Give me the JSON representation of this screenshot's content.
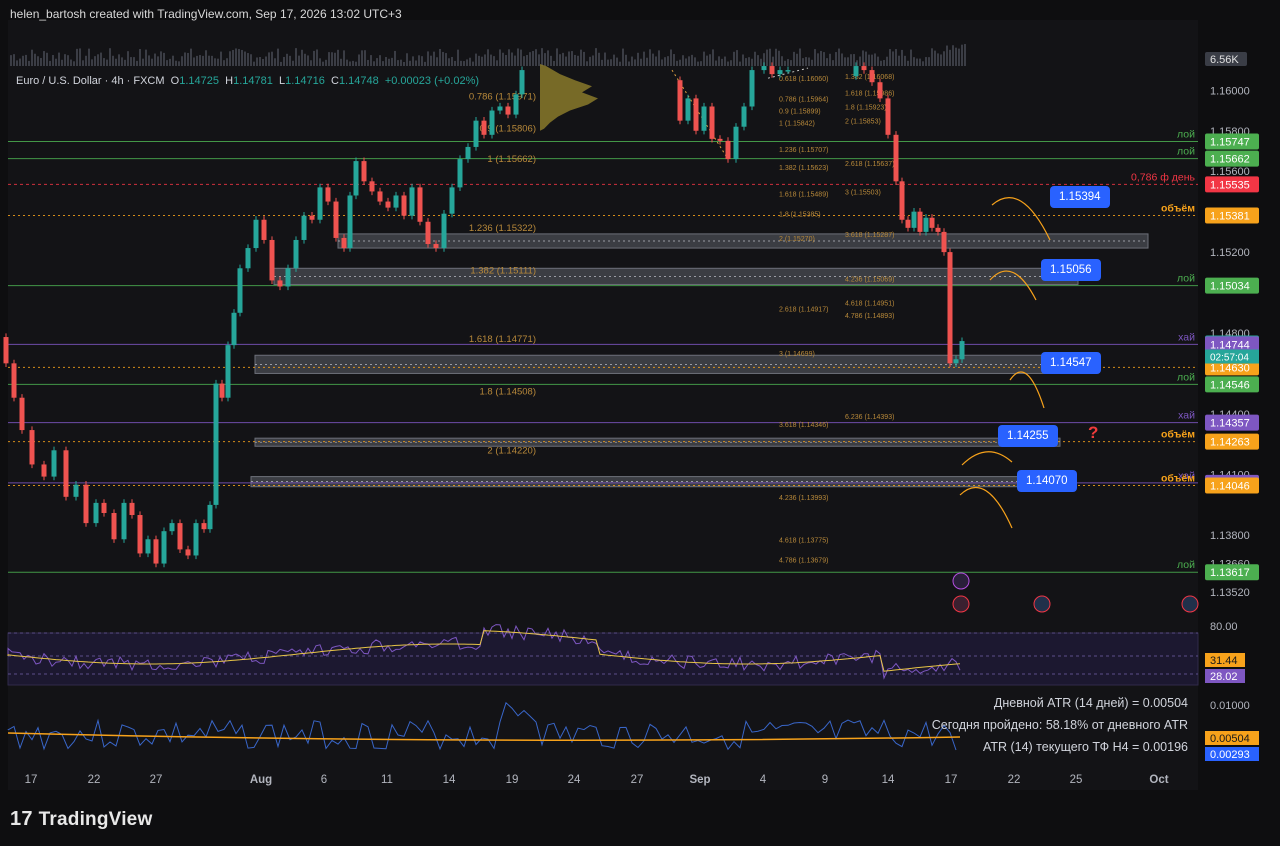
{
  "header": {
    "attribution": "helen_bartosh created with TradingView.com, Sep 17, 2026 13:02 UTC+3"
  },
  "symbol": {
    "name": "Euro / U.S. Dollar · 4h · FXCM",
    "o_label": "O",
    "o": "1.14725",
    "h_label": "H",
    "h": "1.14781",
    "l_label": "L",
    "l": "1.14716",
    "c_label": "C",
    "c": "1.14748",
    "change": "+0.00023 (+0.02%)"
  },
  "volume_badge": "6.56K",
  "colors": {
    "up": "#26a69a",
    "down": "#ef5350",
    "green_level": "#4caf50",
    "red_level": "#f23645",
    "orange": "#f7a21b",
    "purple": "#7e57c2",
    "blue": "#2962ff",
    "fib": "#b8893a",
    "zone": "#5d606b"
  },
  "chart_data": {
    "type": "candlestick",
    "instrument": "Euro / U.S. Dollar",
    "timeframe": "4h",
    "x_ticks": [
      "17",
      "22",
      "27",
      "Aug",
      "6",
      "11",
      "14",
      "19",
      "24",
      "27",
      "Sep",
      "4",
      "9",
      "14",
      "17",
      "22",
      "25",
      "Oct"
    ],
    "ylim": [
      1.1346,
      1.1614
    ],
    "y_ticks": [
      "1.16000",
      "1.15800",
      "1.15600",
      "1.15200",
      "1.14800",
      "1.14400",
      "1.14100",
      "1.13800",
      "1.13660",
      "1.13520"
    ],
    "close_path": [
      [
        0,
        1.1478
      ],
      [
        6,
        1.1465
      ],
      [
        14,
        1.1448
      ],
      [
        22,
        1.1432
      ],
      [
        32,
        1.1415
      ],
      [
        44,
        1.1409
      ],
      [
        54,
        1.1422
      ],
      [
        66,
        1.1399
      ],
      [
        76,
        1.1405
      ],
      [
        86,
        1.1386
      ],
      [
        96,
        1.1396
      ],
      [
        104,
        1.1391
      ],
      [
        114,
        1.1378
      ],
      [
        124,
        1.1396
      ],
      [
        132,
        1.139
      ],
      [
        140,
        1.1371
      ],
      [
        148,
        1.1378
      ],
      [
        156,
        1.1366
      ],
      [
        164,
        1.1382
      ],
      [
        172,
        1.1386
      ],
      [
        180,
        1.1373
      ],
      [
        188,
        1.137
      ],
      [
        196,
        1.1386
      ],
      [
        204,
        1.1383
      ],
      [
        210,
        1.1395
      ],
      [
        216,
        1.1455
      ],
      [
        222,
        1.1448
      ],
      [
        228,
        1.1474
      ],
      [
        234,
        1.149
      ],
      [
        240,
        1.1512
      ],
      [
        248,
        1.1522
      ],
      [
        256,
        1.1536
      ],
      [
        264,
        1.1526
      ],
      [
        272,
        1.1506
      ],
      [
        280,
        1.1503
      ],
      [
        288,
        1.1512
      ],
      [
        296,
        1.1526
      ],
      [
        304,
        1.1538
      ],
      [
        312,
        1.1536
      ],
      [
        320,
        1.1552
      ],
      [
        328,
        1.1545
      ],
      [
        336,
        1.1527
      ],
      [
        344,
        1.1522
      ],
      [
        350,
        1.1548
      ],
      [
        356,
        1.1565
      ],
      [
        364,
        1.1555
      ],
      [
        372,
        1.155
      ],
      [
        380,
        1.1545
      ],
      [
        388,
        1.1542
      ],
      [
        396,
        1.1548
      ],
      [
        404,
        1.1538
      ],
      [
        412,
        1.1552
      ],
      [
        420,
        1.1535
      ],
      [
        428,
        1.1524
      ],
      [
        436,
        1.1522
      ],
      [
        444,
        1.1539
      ],
      [
        452,
        1.1552
      ],
      [
        460,
        1.1566
      ],
      [
        468,
        1.1572
      ],
      [
        476,
        1.1585
      ],
      [
        484,
        1.1578
      ],
      [
        492,
        1.159
      ],
      [
        500,
        1.1592
      ],
      [
        508,
        1.1588
      ],
      [
        516,
        1.1598
      ],
      [
        522,
        1.161
      ],
      [
        672,
        1.1605
      ],
      [
        680,
        1.1585
      ],
      [
        688,
        1.1596
      ],
      [
        696,
        1.158
      ],
      [
        704,
        1.1592
      ],
      [
        712,
        1.1576
      ],
      [
        720,
        1.1575
      ],
      [
        728,
        1.1566
      ],
      [
        736,
        1.1582
      ],
      [
        744,
        1.1592
      ],
      [
        752,
        1.161
      ],
      [
        764,
        1.1612
      ],
      [
        772,
        1.1608
      ],
      [
        780,
        1.161
      ],
      [
        788,
        1.161
      ],
      [
        848,
        1.1607
      ],
      [
        856,
        1.1612
      ],
      [
        864,
        1.161
      ],
      [
        872,
        1.1604
      ],
      [
        880,
        1.1596
      ],
      [
        888,
        1.1578
      ],
      [
        896,
        1.1555
      ],
      [
        902,
        1.1536
      ],
      [
        908,
        1.1532
      ],
      [
        914,
        1.154
      ],
      [
        920,
        1.153
      ],
      [
        926,
        1.1537
      ],
      [
        932,
        1.1532
      ],
      [
        938,
        1.153
      ],
      [
        944,
        1.152
      ],
      [
        950,
        1.1465
      ],
      [
        956,
        1.1467
      ],
      [
        962,
        1.1476
      ]
    ],
    "levels": [
      {
        "price": "1.15747",
        "label": "лой",
        "color": "#4caf50"
      },
      {
        "price": "1.15662",
        "label": "лой",
        "color": "#4caf50"
      },
      {
        "price": "1.15535",
        "label": "0,786 ф день",
        "color": "#f23645"
      },
      {
        "price": "1.15381",
        "label": "объём",
        "color": "#f7a21b"
      },
      {
        "price": "1.15034",
        "label": "лой",
        "color": "#4caf50"
      },
      {
        "price": "1.14748",
        "label": "",
        "color": "#26a69a"
      },
      {
        "price": "1.14744",
        "label": "хай",
        "color": "#7e57c2"
      },
      {
        "price": "1.14630",
        "label": "",
        "color": "#f7a21b"
      },
      {
        "price": "1.14546",
        "label": "лой",
        "color": "#4caf50"
      },
      {
        "price": "1.14357",
        "label": "хай",
        "color": "#7e57c2"
      },
      {
        "price": "1.14263",
        "label": "объём",
        "color": "#f7a21b"
      },
      {
        "price": "1.14059",
        "label": "хай",
        "color": "#7e57c2"
      },
      {
        "price": "1.14046",
        "label": "объём",
        "color": "#f7a21b"
      },
      {
        "price": "1.13617",
        "label": "лой",
        "color": "#4caf50"
      }
    ],
    "countdown": "02:57:04",
    "zones": [
      [
        1.1522,
        1.1529
      ],
      [
        1.1504,
        1.1512
      ],
      [
        1.146,
        1.1469
      ],
      [
        1.1424,
        1.1428
      ],
      [
        1.1404,
        1.1409
      ]
    ],
    "targets": [
      "1.15394",
      "1.15056",
      "1.14547",
      "1.14255",
      "1.14070"
    ],
    "fib_labels_left": [
      {
        "text": "0.786 (1.15971)",
        "price": 1.1597
      },
      {
        "text": "0.9 (1.15806)",
        "price": 1.1581
      },
      {
        "text": "1 (1.15662)",
        "price": 1.1566
      },
      {
        "text": "1.236 (1.15322)",
        "price": 1.1532
      },
      {
        "text": "1.382 (1.15111)",
        "price": 1.1511
      },
      {
        "text": "1.618 (1.14771)",
        "price": 1.1477
      },
      {
        "text": "1.8 (1.14508)",
        "price": 1.1451
      },
      {
        "text": "2 (1.14220)",
        "price": 1.1422
      }
    ],
    "fib_labels_mid": [
      {
        "text": "0.618 (1.16060)",
        "price": 1.1606
      },
      {
        "text": "0.786 (1.15964)",
        "price": 1.1596
      },
      {
        "text": "0.9 (1.15899)",
        "price": 1.159
      },
      {
        "text": "1 (1.15842)",
        "price": 1.1584
      },
      {
        "text": "1.236 (1.15707)",
        "price": 1.1571
      },
      {
        "text": "1.382 (1.15623)",
        "price": 1.1562
      },
      {
        "text": "1.618 (1.15489)",
        "price": 1.1549
      },
      {
        "text": "1.8 (1.15385)",
        "price": 1.1539
      },
      {
        "text": "2 (1.15270)",
        "price": 1.1527
      },
      {
        "text": "2.618 (1.14917)",
        "price": 1.1492
      },
      {
        "text": "3 (1.14699)",
        "price": 1.147
      },
      {
        "text": "3.618 (1.14346)",
        "price": 1.1435
      },
      {
        "text": "4.236 (1.13993)",
        "price": 1.1399
      },
      {
        "text": "4.618 (1.13775)",
        "price": 1.1378
      },
      {
        "text": "4.786 (1.13679)",
        "price": 1.1368
      }
    ],
    "fib_labels_right": [
      {
        "text": "1.382 (1.16068)",
        "price": 1.1607
      },
      {
        "text": "1.618 (1.15986)",
        "price": 1.1599
      },
      {
        "text": "1.8 (1.15923)",
        "price": 1.1592
      },
      {
        "text": "2 (1.15853)",
        "price": 1.1585
      },
      {
        "text": "2.618 (1.15637)",
        "price": 1.1564
      },
      {
        "text": "3 (1.15503)",
        "price": 1.155
      },
      {
        "text": "3.618 (1.15287)",
        "price": 1.1529
      },
      {
        "text": "4.236 (1.15069)",
        "price": 1.1507
      },
      {
        "text": "4.618 (1.14951)",
        "price": 1.1495
      },
      {
        "text": "4.786 (1.14893)",
        "price": 1.1489
      },
      {
        "text": "6.236 (1.14393)",
        "price": 1.1439
      }
    ]
  },
  "rsi": {
    "level_label": "80.00",
    "value_1": "31.44",
    "value_2": "28.02"
  },
  "atr": {
    "axis_label": "0.01000",
    "value_orange": "0.00504",
    "value_blue": "0.00293",
    "line_1": "Дневной ATR (14 дней) = 0.00504",
    "line_2": "Сегодня пройдено: 58.18% от дневного ATR",
    "line_3": "ATR (14) текущего ТФ H4 = 0.00196"
  },
  "footer": {
    "brand": "TradingView"
  }
}
